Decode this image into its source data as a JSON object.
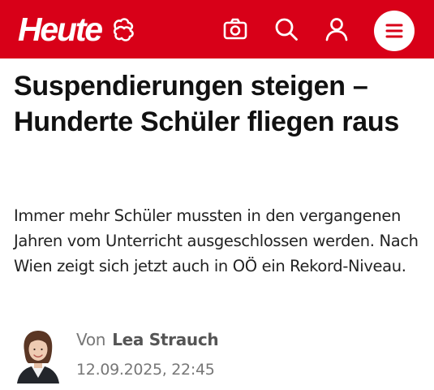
{
  "header": {
    "logo": "Heute",
    "brand_color": "#d80018",
    "icons": [
      "weather-icon",
      "camera-icon",
      "search-icon",
      "user-icon",
      "menu-icon"
    ]
  },
  "article": {
    "headline": "Suspendierungen steigen – Hunderte Schüler fliegen raus",
    "lead": "Immer mehr Schüler mussten in den vergangenen Jahren vom Unterricht ausgeschlossen werden. Nach Wien zeigt sich jetzt auch in OÖ ein Rekord-Niveau.",
    "byline_prefix": "Von",
    "author": "Lea Strauch",
    "date": "12.09.2025, 22:45"
  }
}
